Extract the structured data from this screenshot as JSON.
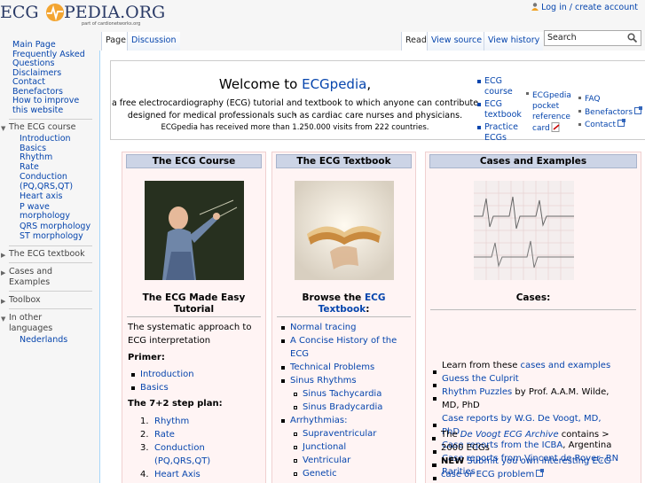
{
  "logo": {
    "text_left": "ECG",
    "text_right": "PEDIA.ORG",
    "subtitle": "part of cardionetworks.org"
  },
  "personal": {
    "login": "Log in / create account"
  },
  "tabs": {
    "page": "Page",
    "discussion": "Discussion",
    "read": "Read",
    "view_source": "View source",
    "view_history": "View history"
  },
  "search": {
    "placeholder": "Search"
  },
  "sidebar": {
    "nav": [
      "Main Page",
      "Frequently Asked",
      "Questions",
      "Disclaimers",
      "Contact",
      "Benefactors",
      "How to improve",
      "this website"
    ],
    "ecg_course": {
      "heading": "The ECG course",
      "items": [
        "Introduction",
        "Basics",
        "Rhythm",
        "Rate",
        "Conduction",
        "(PQ,QRS,QT)",
        "Heart axis",
        "P wave",
        "morphology",
        "QRS morphology",
        "ST morphology"
      ]
    },
    "ecg_textbook": "The ECG textbook",
    "cases_1": "Cases and",
    "cases_2": "Examples",
    "toolbox": "Toolbox",
    "languages_1": "In other",
    "languages_2": "languages",
    "language_item": "Nederlands"
  },
  "welcome": {
    "title_prefix": "Welcome to ",
    "title_link": "ECGpedia",
    "title_suffix": ",",
    "line1": "a free electrocardiography (ECG) tutorial and textbook to which anyone can contribute ,",
    "line2": "designed for medical professionals such as cardiac care nurses and physicians.",
    "line3": "ECGpedia has received more than 1.250.000 visits from 222 countries.",
    "links_col1": [
      "ECG",
      "course",
      "ECG",
      "textbook",
      "Practice",
      "ECGs"
    ],
    "links_col2": [
      "ECGpedia",
      "pocket",
      "reference",
      "card"
    ],
    "links_col3": [
      "FAQ",
      "Benefactors",
      "Contact"
    ]
  },
  "course_col": {
    "header": "The ECG Course",
    "title_1": "The ECG Made Easy",
    "title_2": "Tutorial",
    "desc_1": "The systematic approach to",
    "desc_2": "ECG interpretation",
    "primer": "Primer:",
    "primer_items": [
      "Introduction",
      "Basics"
    ],
    "plan": "The 7+2 step plan:",
    "plan_items": [
      "Rhythm",
      "Rate",
      "Conduction",
      "(PQ,QRS,QT)",
      "Heart Axis"
    ],
    "plan_nums": [
      "1.",
      "2.",
      "3.",
      "4."
    ]
  },
  "textbook_col": {
    "header": "The ECG Textbook",
    "title_1": "Browse the ",
    "title_link_1": "ECG",
    "title_link_2": "Textbook",
    "title_end": ":",
    "items": [
      "Normal tracing",
      "A Concise History of the",
      "ECG",
      "Technical Problems",
      "Sinus Rhythms",
      "Sinus Tachycardia",
      "Sinus Bradycardia",
      "Arrhythmias:",
      "Supraventricular",
      "Junctional",
      "Ventricular",
      "Genetic"
    ]
  },
  "cases_col": {
    "header": "Cases and Examples",
    "title": "Cases:",
    "l1_prefix": "Learn from these ",
    "l1_link": "cases and examples",
    "l2": "Guess the Culprit",
    "l3_link": "Rhythm Puzzles",
    "l3_suffix": " by Prof. A.A.M. Wilde,",
    "l3_cont": "MD, PhD",
    "l4_link": "Case reports by W.G. De Voogt, MD,",
    "l4_cont": "PhD",
    "l5_link": "Case reports from the ICBA",
    "l5_suffix": ", Argentina",
    "l6_link": "Case reports from Vincent de Rover, RN",
    "l7": "Rarities",
    "l8_prefix": "The ",
    "l8_link": "De Voogt ECG Archive",
    "l8_suffix": " contains >",
    "l8_cont": "2000 ECGs",
    "l9_bold": "NEW",
    "l9_link": "Submit you own interesting ECG",
    "l9_cont": "case or ECG problem"
  },
  "colors": {
    "link": "#0645ad",
    "header_bg": "#ccd4e6",
    "panel_bg": "#fff4f4"
  }
}
